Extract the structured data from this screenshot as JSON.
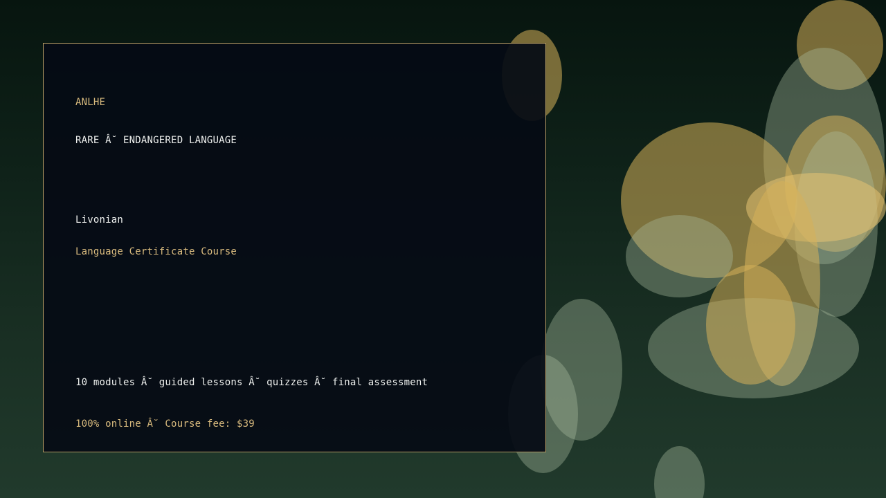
{
  "brand": "ANLHE",
  "tagline": "RARE Â˘ ENDANGERED LANGUAGE",
  "language": "Livonian",
  "course_title": "Language Certificate Course",
  "details": "10 modules Â˘ guided lessons Â˘ quizzes Â˘ final assessment",
  "pricing": "100% online Â˘ Course fee: $39",
  "colors": {
    "accent_gold": "#d9bb7e",
    "card_background": "#050b14",
    "card_border": "#b59b63",
    "text_white": "#eef0ee",
    "background_green": "#1a3024"
  }
}
